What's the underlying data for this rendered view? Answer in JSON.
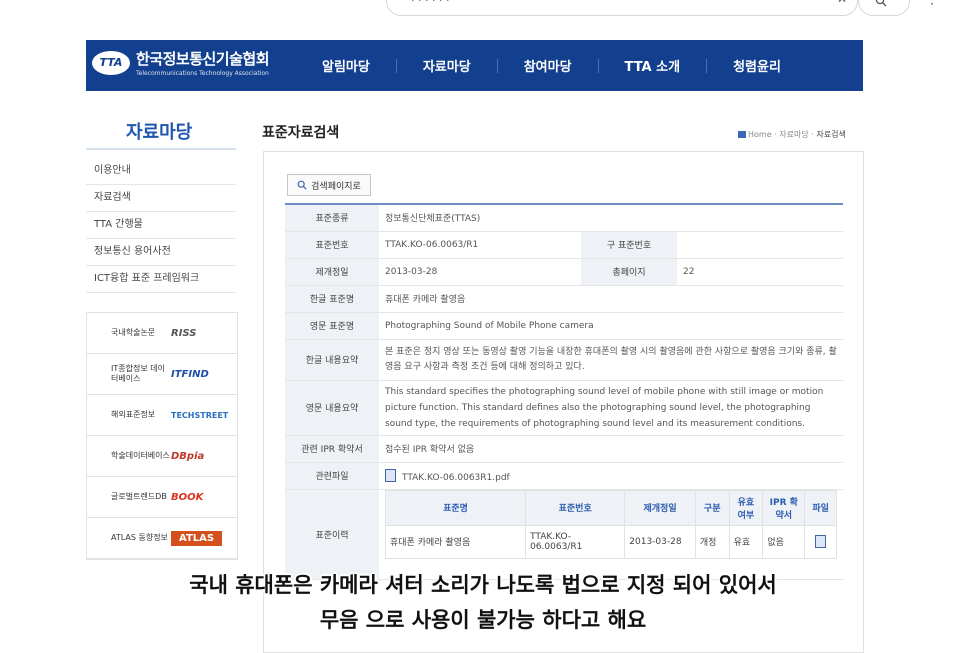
{
  "browser": {
    "search_text": ". . . . . .",
    "clear_icon": "close-icon",
    "search_icon": "search-icon",
    "extra": "·"
  },
  "header": {
    "logo_mark": "TTA",
    "logo_ko": "한국정보통신기술협회",
    "logo_en": "Telecommunications Technology Association",
    "nav": [
      "알림마당",
      "자료마당",
      "참여마당",
      "TTA 소개",
      "청렴윤리"
    ],
    "bg_color": "#12408e"
  },
  "sidebar": {
    "title": "자료마당",
    "items": [
      "이용안내",
      "자료검색",
      "TTA 간행물",
      "정보통신 용어사전",
      "ICT융합 표준 프레임워크"
    ],
    "banners": [
      {
        "label": "국내학술논문",
        "brand": "RISS"
      },
      {
        "label": "IT종합정보 데이터베이스",
        "brand": "ITFIND"
      },
      {
        "label": "해외표준정보",
        "brand": "TECHSTREET"
      },
      {
        "label": "학술데이터베이스",
        "brand": "DBpia"
      },
      {
        "label": "글로벌트렌드DB",
        "brand": "BOOK"
      },
      {
        "label": "ATLAS 동향정보",
        "brand": "ATLAS"
      }
    ]
  },
  "main": {
    "title": "표준자료검색",
    "breadcrumb": {
      "home": "Home",
      "sep": "·",
      "section": "자료마당",
      "current": "자료검색"
    },
    "search_page_button": "검색페이지로",
    "rows": {
      "type_label": "표준종류",
      "type_value": "정보통신단체표준(TTAS)",
      "number_label": "표준번호",
      "number_value": "TTAK.KO-06.0063/R1",
      "old_number_label": "구 표준번호",
      "old_number_value": "",
      "date_label": "제개정일",
      "date_value": "2013-03-28",
      "pages_label": "총페이지",
      "pages_value": "22",
      "ko_name_label": "한글 표준명",
      "ko_name_value": "휴대폰 카메라 촬영음",
      "en_name_label": "영문 표준명",
      "en_name_value": "Photographing Sound of Mobile Phone camera",
      "ko_summary_label": "한글 내용요약",
      "ko_summary_value": "본 표준은 정지 영상 또는 동영상 촬영 기능을 내장한 휴대폰의 촬영 시의 촬영음에 관한 사항으로 촬영음 크기와 종류, 촬영음 요구 사항과 측정 조건 등에 대해 정의하고 있다.",
      "en_summary_label": "영문 내용요약",
      "en_summary_value": "This standard specifies the photographing sound level of mobile phone with still image or motion picture function. This standard defines also the photographing sound level, the photographing sound type, the requirements of photographing sound level and its measurement conditions.",
      "ipr_label": "관련 IPR 확약서",
      "ipr_value": "접수된 IPR 확약서 없음",
      "file_label": "관련파일",
      "file_value": "TTAK.KO-06.0063R1.pdf",
      "history_label": "표준이력"
    },
    "history": {
      "headers": [
        "표준명",
        "표준번호",
        "제개정일",
        "구분",
        "유효 여부",
        "IPR 확약서",
        "파일"
      ],
      "row": [
        "휴대폰 카메라 촬영음",
        "TTAK.KO-06.0063/R1",
        "2013-03-28",
        "개정",
        "유효",
        "없음"
      ]
    }
  },
  "caption": {
    "line1": "국내 휴대폰은 카메라 셔터 소리가 나도록 법으로 지정 되어 있어서",
    "line2": "무음 으로 사용이 불가능 하다고 해요"
  }
}
